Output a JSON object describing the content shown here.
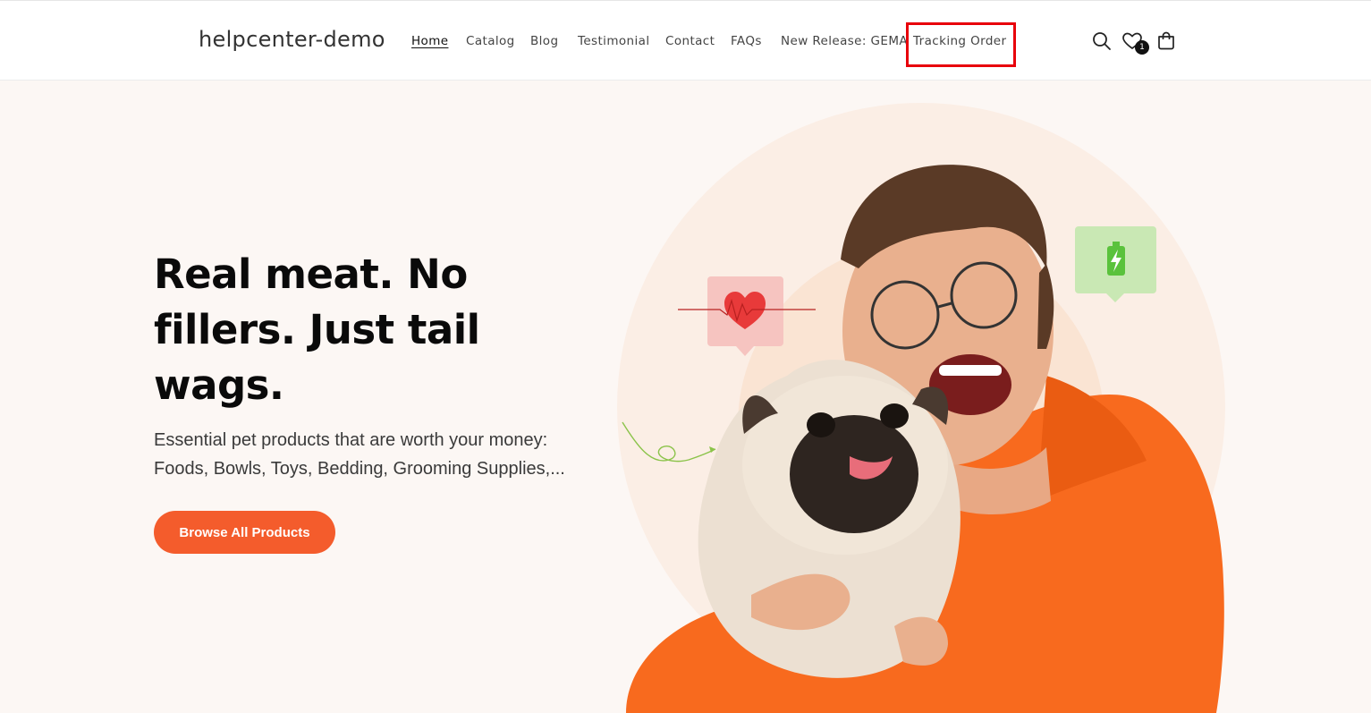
{
  "header": {
    "logo": "helpcenter-demo",
    "nav": [
      {
        "label": "Home",
        "active": true
      },
      {
        "label": "Catalog"
      },
      {
        "label": "Blog"
      },
      {
        "label": "Testimonial"
      },
      {
        "label": "Contact"
      },
      {
        "label": "FAQs"
      },
      {
        "label": "New Release: GEMA"
      },
      {
        "label": "Tracking Order",
        "highlighted": true
      }
    ],
    "icons": [
      "search-icon",
      "wishlist-heart-icon",
      "cart-bag-icon"
    ],
    "wishlist_count": "1"
  },
  "hero": {
    "heading": "Real meat. No fillers. Just tail wags.",
    "subtext": "Essential pet products that are worth your money: Foods, Bowls, Toys, Bedding, Grooming Supplies,...",
    "cta_label": "Browse All Products"
  },
  "colors": {
    "accent": "#f45c2c",
    "hero_background": "#fcf7f4",
    "highlight_box": "#e8000b",
    "hoodie": "#f86a1e"
  }
}
